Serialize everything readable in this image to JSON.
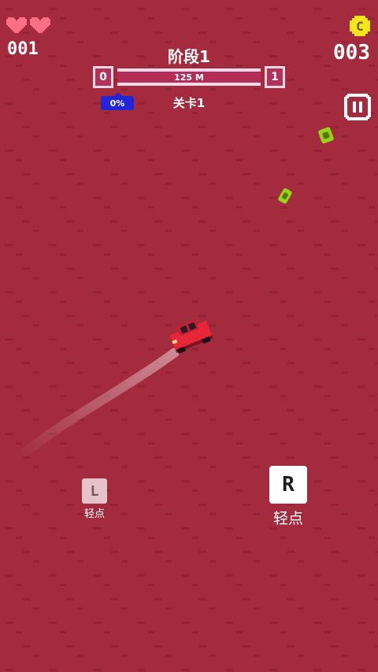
{
  "colors": {
    "background": "#a32b3d",
    "accent_blue": "#2525d8",
    "coin": "#f6e61c",
    "heart": "#ff6f84",
    "car": "#e8263a",
    "gem": "#98d21c"
  },
  "hud": {
    "lives_icons": [
      "heart-icon",
      "heart-icon"
    ],
    "lives_count": "001",
    "coin_icon_letter": "C",
    "coin_count": "003",
    "pause_icon": "pause-icon"
  },
  "stage": {
    "title": "阶段1",
    "start": "0",
    "end": "1",
    "distance": "125 M",
    "progress_percent": 0,
    "progress_label": "0%",
    "level_label": "关卡1"
  },
  "controls": {
    "left_key": "L",
    "left_label": "轻点",
    "right_key": "R",
    "right_label": "轻点"
  }
}
